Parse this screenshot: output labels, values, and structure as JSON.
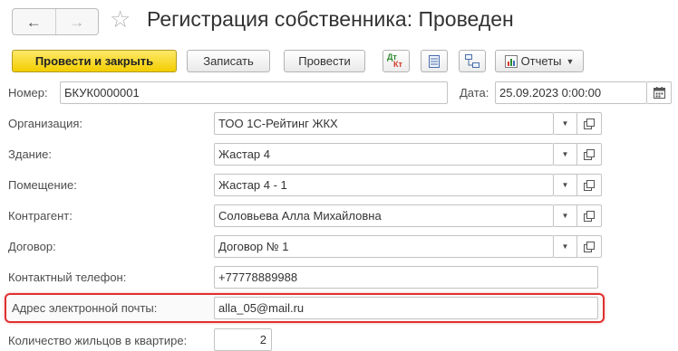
{
  "window": {
    "title": "Регистрация собственника: Проведен",
    "nav_back": "←",
    "nav_forward": "→",
    "favorite": "☆"
  },
  "toolbar": {
    "post_close_label": "Провести и закрыть",
    "save_label": "Записать",
    "post_label": "Провести",
    "dt_label": "Дт",
    "kt_label": "Кт",
    "reports_label": "Отчеты"
  },
  "form": {
    "number": {
      "label": "Номер:",
      "value": "БКУК0000001"
    },
    "date": {
      "label": "Дата:",
      "value": "25.09.2023  0:00:00"
    },
    "organization": {
      "label": "Организация:",
      "value": "ТОО 1С-Рейтинг ЖКХ"
    },
    "building": {
      "label": "Здание:",
      "value": "Жастар 4"
    },
    "room": {
      "label": "Помещение:",
      "value": "Жастар 4 - 1"
    },
    "counterparty": {
      "label": "Контрагент:",
      "value": "Соловьева Алла Михайловна"
    },
    "contract": {
      "label": "Договор:",
      "value": "Договор № 1"
    },
    "phone": {
      "label": "Контактный телефон:",
      "value": "+77778889988"
    },
    "email": {
      "label": "Адрес электронной почты:",
      "value": "alla_05@mail.ru"
    },
    "residents": {
      "label": "Количество жильцов в квартире:",
      "value": "2"
    }
  },
  "colors": {
    "primary_button": "#f3cd00",
    "highlight_border": "#e0302f",
    "label_text": "#4d4d4d"
  },
  "icons": [
    "back-arrow-icon",
    "forward-arrow-icon",
    "star-icon",
    "dt-kt-icon",
    "list-icon",
    "structure-icon",
    "reports-icon",
    "calendar-icon",
    "dropdown-icon",
    "open-icon"
  ]
}
